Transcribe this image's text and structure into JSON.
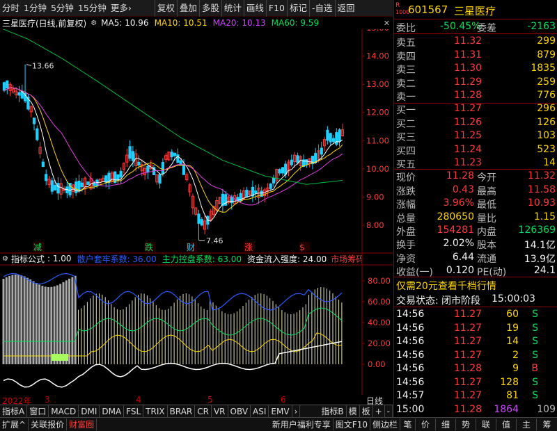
{
  "toolbar": {
    "left": [
      "分时",
      "1分钟",
      "5分钟",
      "15分钟",
      "更多›"
    ],
    "right": [
      "复权",
      "叠加",
      "多股",
      "统计",
      "画线",
      "F10",
      "标记",
      "-自选",
      "返回"
    ]
  },
  "chart_title": "三星医疗(日线,前复权)",
  "ma": {
    "ma5": "MA5: 10.96",
    "ma10": "MA10: 10.51",
    "ma20": "MA20: 10.13",
    "ma60": "MA60: 9.59"
  },
  "indicator": {
    "name": "指标公式",
    "v1": ": 1.00",
    "v2": "散户套牢系数: 36.00",
    "v3": "主力控盘系数: 63.00",
    "v4": "资金流入强度: 24.00",
    "v5": "市场筹码总数"
  },
  "dates": {
    "year": "2022年",
    "m3": "3",
    "m4": "4",
    "m5": "5",
    "m6": "6",
    "period": "日线"
  },
  "chart_data": {
    "type": "candlestick",
    "price_axis": [
      15.0,
      14.0,
      13.0,
      12.0,
      11.0,
      10.0,
      9.0,
      8.0
    ],
    "indicator_axis": [
      80.0,
      60.0,
      40.0,
      20.0,
      0.0
    ],
    "annotations": {
      "high": "13.66",
      "low": "7.46"
    },
    "markers": [
      "减",
      "跌",
      "财",
      "涨",
      "$"
    ],
    "colors": {
      "up": "#ff3b3b",
      "down": "#1fd0ff",
      "ma5": "#ffffff",
      "ma10": "#ffd700",
      "ma20": "#e040e0",
      "ma60": "#00c040"
    }
  },
  "bottom_tabs": {
    "items": [
      "指标A",
      "窗口",
      "MACD",
      "DMI",
      "DMA",
      "FSL",
      "TRIX",
      "BRAR",
      "CR",
      "VR",
      "OBV",
      "ASI",
      "EMV",
      "›"
    ],
    "right": [
      "指标B",
      "模",
      "板",
      "+",
      "-"
    ]
  },
  "status_bar": {
    "left": [
      "扩展^",
      "关联报价",
      "财富圈"
    ],
    "mid": [
      "新用户福利专享",
      "图文F10",
      "侧边栏"
    ],
    "right": [
      "笔",
      "价",
      "细",
      "势",
      "联",
      "值",
      "主",
      "筹"
    ]
  },
  "stock": {
    "code": "601567",
    "name": "三星医疗",
    "badge": "R",
    "badge2": "1000"
  },
  "book": {
    "wb_label": "委比",
    "wb": "-50.45%",
    "wc_label": "委差",
    "wc": "-2163",
    "asks": [
      {
        "l": "卖五",
        "p": "11.32",
        "v": "299"
      },
      {
        "l": "卖四",
        "p": "11.31",
        "v": "879"
      },
      {
        "l": "卖三",
        "p": "11.30",
        "v": "1835"
      },
      {
        "l": "卖二",
        "p": "11.29",
        "v": "259"
      },
      {
        "l": "卖一",
        "p": "11.28",
        "v": "776"
      }
    ],
    "bids": [
      {
        "l": "买一",
        "p": "11.27",
        "v": "296"
      },
      {
        "l": "买二",
        "p": "11.26",
        "v": "126"
      },
      {
        "l": "买三",
        "p": "11.25",
        "v": "103"
      },
      {
        "l": "买四",
        "p": "11.24",
        "v": "523"
      },
      {
        "l": "买五",
        "p": "11.23",
        "v": "14"
      }
    ]
  },
  "quote": {
    "r1": {
      "a": "现价",
      "b": "11.28",
      "c": "今开",
      "d": "11.32"
    },
    "r2": {
      "a": "涨跌",
      "b": "0.43",
      "c": "最高",
      "d": "11.58"
    },
    "r3": {
      "a": "涨幅",
      "b": "3.96%",
      "c": "最低",
      "d": "10.93"
    },
    "r4": {
      "a": "总量",
      "b": "280650",
      "c": "量比",
      "d": "1.15"
    },
    "r5": {
      "a": "外盘",
      "b": "154281",
      "c": "内盘",
      "d": "126369"
    },
    "r6": {
      "a": "换手",
      "b": "2.02%",
      "c": "股本",
      "d": "14.1亿"
    },
    "r7": {
      "a": "净资",
      "b": "6.44",
      "c": "流通",
      "d": "13.9亿"
    },
    "r8": {
      "a": "收益(一)",
      "b": "0.120",
      "c": "PE(动)",
      "d": "24.1"
    }
  },
  "promo": "仅需20元查看千档行情",
  "trade_state": {
    "label": "交易状态:",
    "state": "闭市阶段",
    "time": "15:00:03"
  },
  "ticks": [
    {
      "t": "14:56",
      "p": "11.27",
      "v": "60",
      "s": "S"
    },
    {
      "t": "14:56",
      "p": "11.27",
      "v": "19",
      "s": "S"
    },
    {
      "t": "14:56",
      "p": "11.27",
      "v": "14",
      "s": "S"
    },
    {
      "t": "14:56",
      "p": "11.27",
      "v": "2",
      "s": "S"
    },
    {
      "t": "14:56",
      "p": "11.28",
      "v": "9",
      "s": "B"
    },
    {
      "t": "14:56",
      "p": "11.27",
      "v": "128",
      "s": "S"
    },
    {
      "t": "14:57",
      "p": "11.27",
      "v": "81",
      "s": "S"
    },
    {
      "t": "15:00",
      "p": "11.28",
      "v": "1864",
      "s": "109"
    }
  ]
}
